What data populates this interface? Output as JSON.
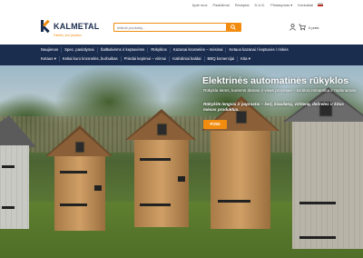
{
  "topbar": {
    "links": [
      "Apie mus",
      "Pasiūlimai",
      "Receptai",
      "D.U.K.",
      "Pristatymas ▾",
      "Kontaktai"
    ]
  },
  "header": {
    "logo_text": "KALMETAL",
    "tagline": "Patirtis, kuri jaudina",
    "search_placeholder": "Ieškoti produktų...",
    "cart_label": "0 prek."
  },
  "nav": {
    "row1": [
      "Naujienos",
      "Spec. pasiūlymai",
      "Šaltkalvėms ir keptuvėms",
      "Rūkyklos",
      "Kazanai krosnelės – mėsinai",
      "Ketaus kazanai / keptuvės / rinkės"
    ],
    "row2": [
      "Ketaus ▾",
      "Ketiai kuro krosnelės, burbuikas",
      "Priedai kepimui – virimui",
      "Kalėdiniai baldai",
      "BBQ komercijai",
      "Kita ▾"
    ]
  },
  "hero": {
    "title": "Elektrinės automatinės rūkyklos",
    "description": "Rūkykla tiems, kuriems dūmas ir visas procesas – tai tikra romantika ir malonumas.",
    "highlight": "Rūkykite lengvai ir paprastai – šerį, kiaulieną, vištieną, dešreles ir kitus mėsos produktus.",
    "button_label": "Pirkti"
  },
  "colors": {
    "accent": "#f28c0f",
    "nav_bg": "#1b2d4f"
  },
  "icons": {
    "search": "search-icon",
    "user": "user-icon",
    "cart": "cart-icon"
  }
}
